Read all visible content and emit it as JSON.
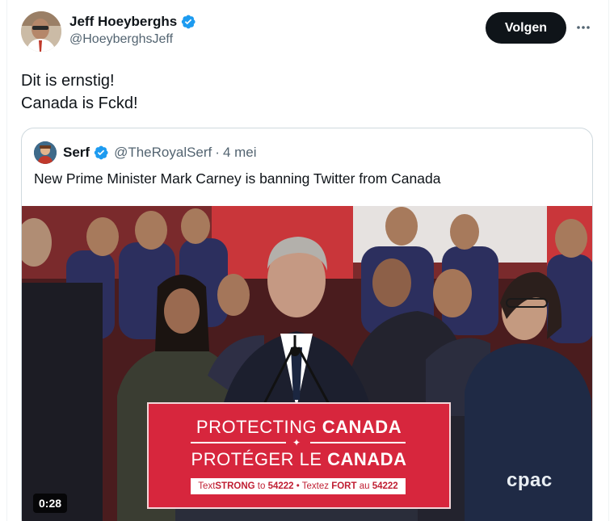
{
  "author": {
    "display_name": "Jeff Hoeyberghs",
    "handle": "@HoeyberghsJeff",
    "verified": true,
    "verified_color": "#1d9bf0"
  },
  "actions": {
    "follow_label": "Volgen",
    "more_icon": "more-horizontal-icon"
  },
  "tweet": {
    "lines": [
      "Dit is ernstig!",
      "Canada is Fckd!"
    ]
  },
  "quote": {
    "display_name": "Serf",
    "handle": "@TheRoyalSerf",
    "separator": "·",
    "date": "4 mei",
    "text": "New Prime Minister Mark Carney is banning Twitter from Canada",
    "media": {
      "sign_line1_a": "PROTECTING ",
      "sign_line1_b": "CANADA",
      "sign_line2_a": "PROTÉGER LE ",
      "sign_line2_b": "CANADA",
      "sign_bar_t1": "Text ",
      "sign_bar_b1": "STRONG",
      "sign_bar_t2": " to ",
      "sign_bar_b2": "54222",
      "sign_bar_t3": " • Textez ",
      "sign_bar_b3": "FORT",
      "sign_bar_t4": " au ",
      "sign_bar_b4": "54222",
      "watermark": "cpac",
      "duration": "0:28"
    }
  }
}
